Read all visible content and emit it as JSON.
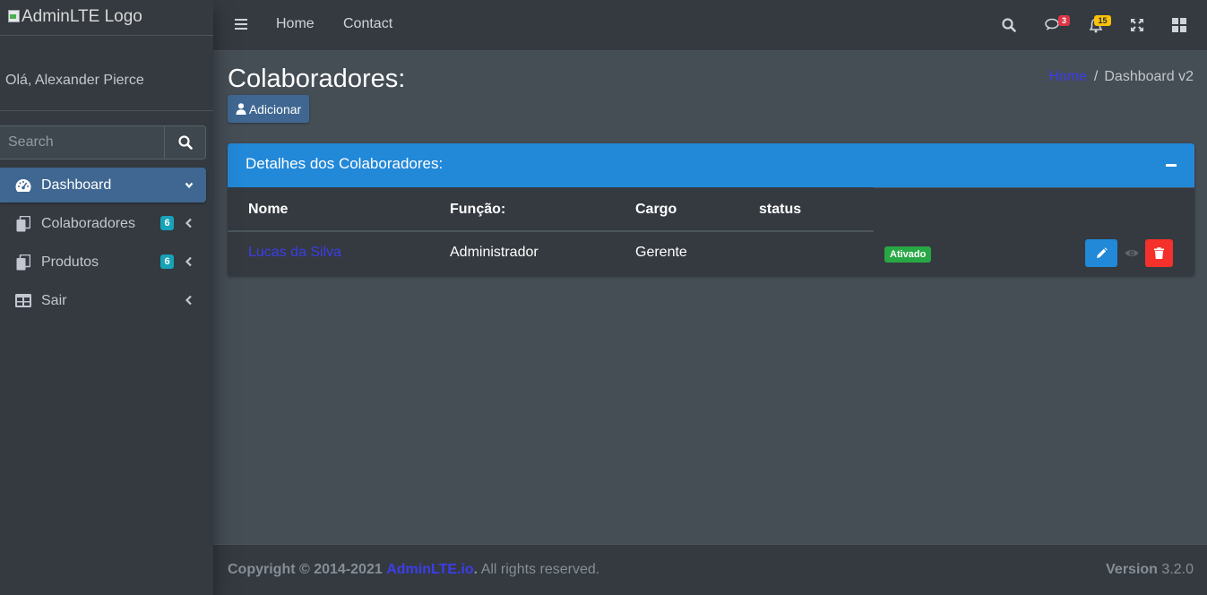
{
  "brand": {
    "logo_alt": "AdminLTE Logo"
  },
  "user_panel": {
    "greeting": "Olá, Alexander Pierce"
  },
  "sidebar": {
    "search_placeholder": "Search",
    "items": [
      {
        "label": "Dashboard",
        "icon": "tachometer-icon",
        "active": true
      },
      {
        "label": "Colaboradores",
        "icon": "copy-icon",
        "badge": "6"
      },
      {
        "label": "Produtos",
        "icon": "copy-icon",
        "badge": "6"
      },
      {
        "label": "Sair",
        "icon": "table-icon"
      }
    ]
  },
  "navbar": {
    "links": [
      "Home",
      "Contact"
    ],
    "messages_badge": "3",
    "notifications_badge": "15",
    "colors": {
      "messages_badge": "#dc3545",
      "notifications_badge": "#ffc107"
    }
  },
  "page": {
    "title": "Colaboradores:",
    "add_button": "Adicionar",
    "breadcrumb": {
      "home": "Home",
      "current": "Dashboard v2"
    }
  },
  "card": {
    "title": "Detalhes dos Colaboradores:",
    "columns": [
      "Nome",
      "Função:",
      "Cargo",
      "status"
    ],
    "rows": [
      {
        "nome": "Lucas da Silva",
        "funcao": "Administrador",
        "cargo": "Gerente",
        "status": "Ativado"
      }
    ]
  },
  "footer": {
    "copyright_prefix": "Copyright © 2014-2021",
    "brand_link": "AdminLTE.io",
    "suffix": ". All rights reserved.",
    "version_label": "Version",
    "version_value": "3.2.0"
  }
}
